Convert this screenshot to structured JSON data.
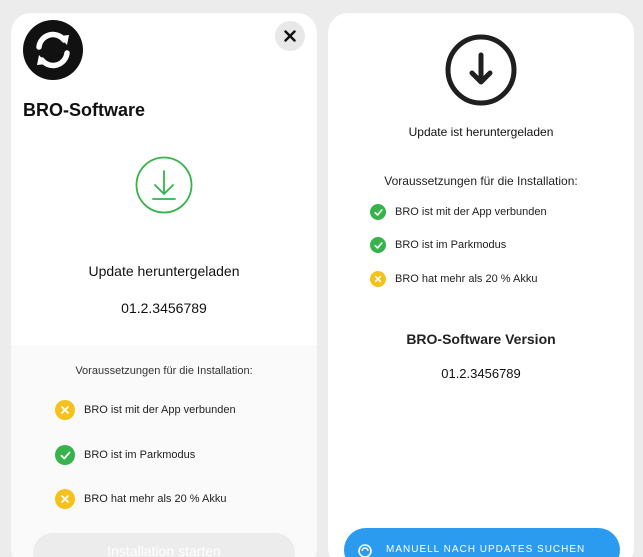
{
  "left_panel": {
    "brand": "BRO-Software",
    "status_title": "Update heruntergeladen",
    "version": "01.2.3456789",
    "requirements_title": "Voraussetzungen für die Installation:",
    "requirements": [
      {
        "text": "BRO ist mit der App verbunden",
        "status": "warning"
      },
      {
        "text": "BRO ist im Parkmodus",
        "status": "ok"
      },
      {
        "text": "BRO hat mehr als 20 % Akku",
        "status": "warning"
      }
    ],
    "install_button": "Installation starten",
    "icons": {
      "logo": "sync-icon",
      "close": "close-icon",
      "download": "download-icon"
    }
  },
  "right_panel": {
    "status_title": "Update ist heruntergeladen",
    "requirements_title": "Voraussetzungen für die Installation:",
    "requirements": [
      {
        "text": "BRO ist mit der App verbunden",
        "status": "ok"
      },
      {
        "text": "BRO ist im Parkmodus",
        "status": "ok"
      },
      {
        "text": "BRO hat mehr als 20 % Akku",
        "status": "warning"
      }
    ],
    "version_title": "BRO-Software Version",
    "version": "01.2.3456789",
    "manual_button": "MANUELL NACH UPDATES SUCHEN",
    "icons": {
      "download": "download-icon",
      "refresh": "refresh-icon"
    }
  },
  "colors": {
    "ok": "#36b34a",
    "warning": "#f6c11a",
    "primary_button": "#2b9bef",
    "disabled_button": "#ececec"
  }
}
